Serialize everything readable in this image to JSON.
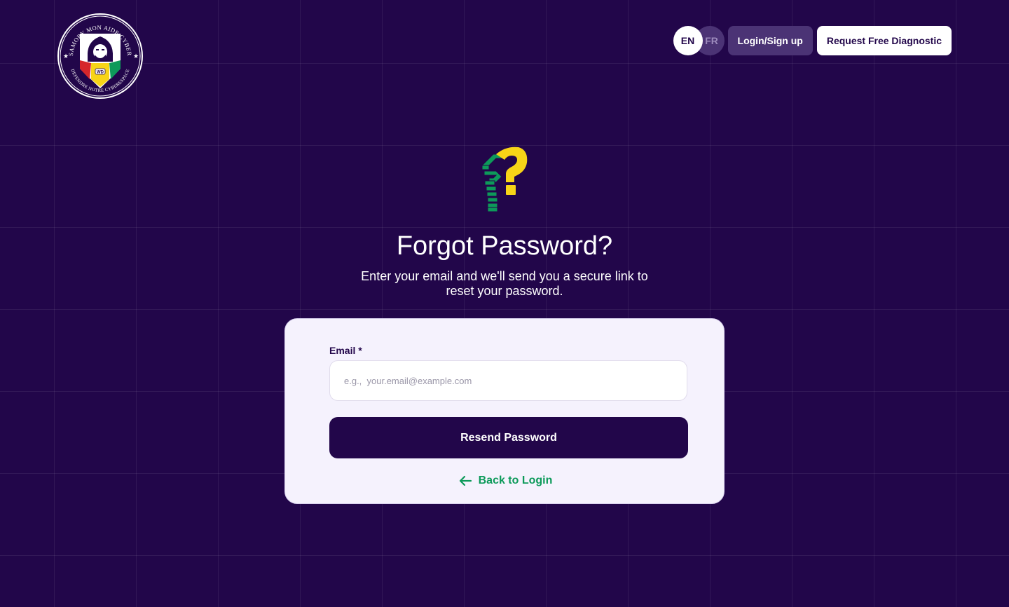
{
  "brand": {
    "logo_top_text": "SAMORY MON AIDE CYBER",
    "logo_bottom_text": "DEFENDRE NOTRE CYBERESPACE",
    "logo_badge": "WD"
  },
  "nav": {
    "lang_en": "EN",
    "lang_fr": "FR",
    "lang_selected": "EN",
    "login_label": "Login/Sign up",
    "diagnostic_label": "Request Free Diagnostic"
  },
  "hero": {
    "icon": "question-mark-icon",
    "title": "Forgot Password?",
    "subtitle": "Enter your email and we'll send you a secure link to reset your password."
  },
  "form": {
    "email_label": "Email *",
    "email_placeholder": "e.g.,  your.email@example.com",
    "email_value": "",
    "submit_label": "Resend Password",
    "back_label": "Back to Login",
    "back_icon": "arrow-left-icon"
  },
  "colors": {
    "background": "#22064a",
    "card": "#f5f2fd",
    "primary": "#22064a",
    "accent_green": "#0d9a5a",
    "accent_yellow": "#f7d417"
  }
}
